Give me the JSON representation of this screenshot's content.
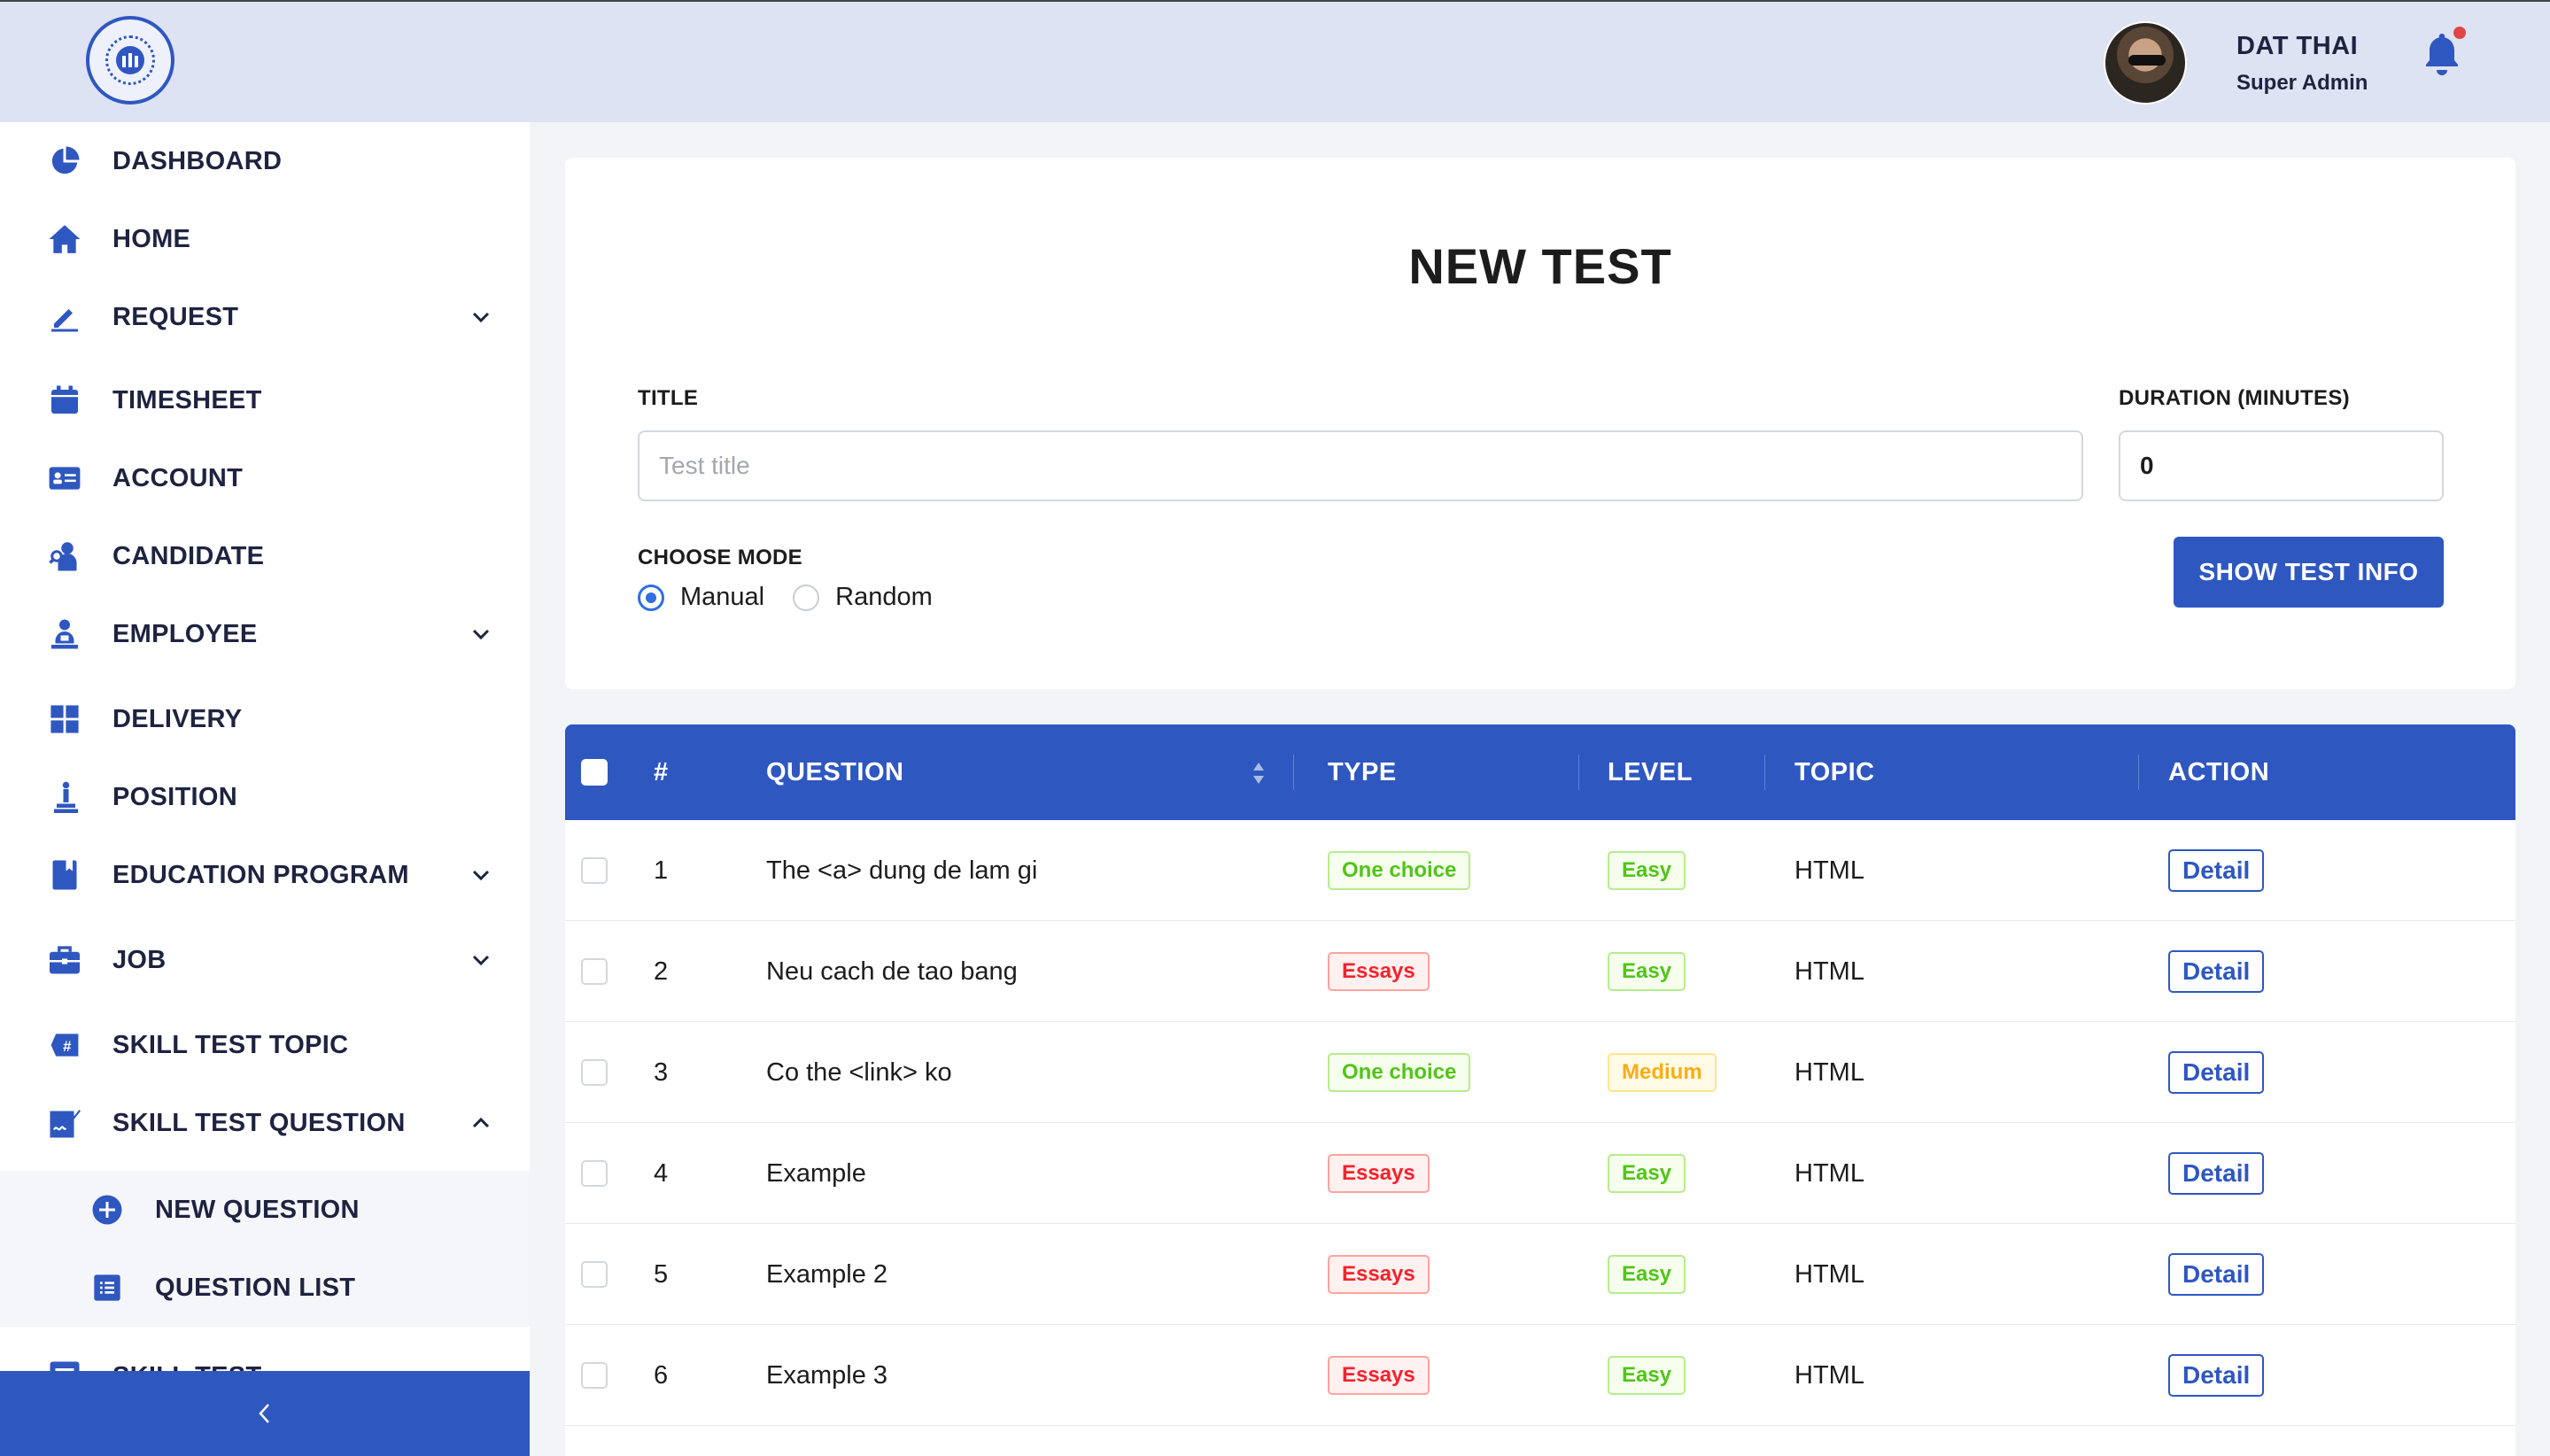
{
  "header": {
    "user_name": "DAT THAI",
    "user_role": "Super Admin"
  },
  "sidebar": {
    "items": [
      {
        "label": "DASHBOARD",
        "icon": "pie-chart-icon"
      },
      {
        "label": "HOME",
        "icon": "home-icon"
      },
      {
        "label": "REQUEST",
        "icon": "pencil-icon",
        "expandable": true
      },
      {
        "label": "TIMESHEET",
        "icon": "calendar-icon"
      },
      {
        "label": "ACCOUNT",
        "icon": "id-card-icon"
      },
      {
        "label": "CANDIDATE",
        "icon": "user-search-icon"
      },
      {
        "label": "EMPLOYEE",
        "icon": "employee-icon",
        "expandable": true
      },
      {
        "label": "DELIVERY",
        "icon": "grid-icon"
      },
      {
        "label": "POSITION",
        "icon": "chess-pawn-icon"
      },
      {
        "label": "EDUCATION PROGRAM",
        "icon": "book-icon",
        "expandable": true
      },
      {
        "label": "JOB",
        "icon": "briefcase-icon",
        "expandable": true
      },
      {
        "label": "SKILL TEST TOPIC",
        "icon": "hashtag-icon"
      },
      {
        "label": "SKILL TEST QUESTION",
        "icon": "signature-icon",
        "expanded": true
      },
      {
        "label": "SKILL TEST",
        "icon": "list-icon",
        "expanded": true
      }
    ],
    "subitems": [
      {
        "label": "NEW QUESTION",
        "icon": "plus-circle-icon"
      },
      {
        "label": "QUESTION LIST",
        "icon": "list-icon"
      }
    ]
  },
  "form": {
    "title": "NEW TEST",
    "title_label": "TITLE",
    "title_placeholder": "Test title",
    "duration_label": "DURATION (MINUTES)",
    "duration_value": "0",
    "mode_label": "CHOOSE MODE",
    "mode_options": [
      "Manual",
      "Random"
    ],
    "mode_selected": "Manual",
    "show_info_button": "SHOW TEST INFO"
  },
  "table": {
    "columns": {
      "index": "#",
      "question": "QUESTION",
      "type": "TYPE",
      "level": "LEVEL",
      "topic": "TOPIC",
      "action": "ACTION"
    },
    "rows": [
      {
        "index": "1",
        "question": "The <a> dung de lam gi",
        "type": "One choice",
        "level": "Easy",
        "topic": "HTML",
        "action": "Detail"
      },
      {
        "index": "2",
        "question": "Neu cach de tao bang",
        "type": "Essays",
        "level": "Easy",
        "topic": "HTML",
        "action": "Detail"
      },
      {
        "index": "3",
        "question": "Co the <link> ko",
        "type": "One choice",
        "level": "Medium",
        "topic": "HTML",
        "action": "Detail"
      },
      {
        "index": "4",
        "question": "Example",
        "type": "Essays",
        "level": "Easy",
        "topic": "HTML",
        "action": "Detail"
      },
      {
        "index": "5",
        "question": "Example 2",
        "type": "Essays",
        "level": "Easy",
        "topic": "HTML",
        "action": "Detail"
      },
      {
        "index": "6",
        "question": "Example 3",
        "type": "Essays",
        "level": "Easy",
        "topic": "HTML",
        "action": "Detail"
      }
    ]
  },
  "colors": {
    "primary": "#2f57c0",
    "header_bg": "#dde3f3",
    "tag_green": "#52c41a",
    "tag_red": "#f5222d",
    "tag_gold": "#faad14"
  }
}
